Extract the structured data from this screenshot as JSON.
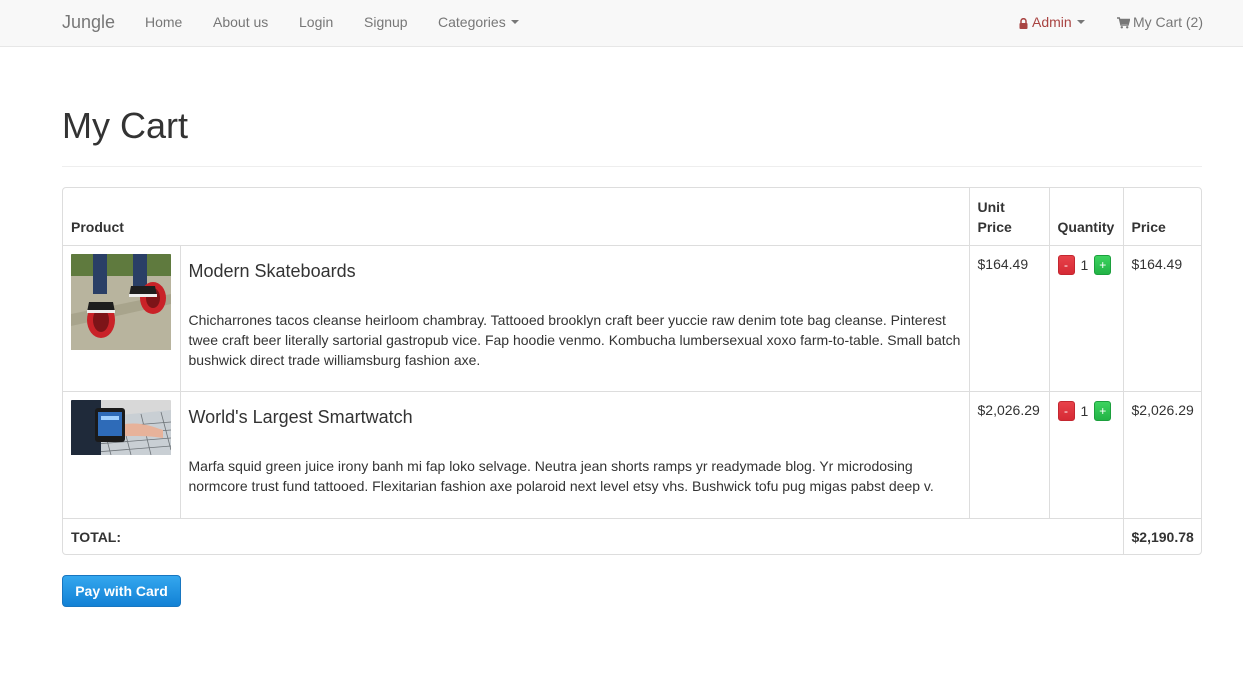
{
  "nav": {
    "brand": "Jungle",
    "links": [
      "Home",
      "About us",
      "Login",
      "Signup"
    ],
    "categories": "Categories",
    "admin": "Admin",
    "cart": "My Cart (2)"
  },
  "page": {
    "title": "My Cart"
  },
  "table": {
    "headers": {
      "product": "Product",
      "unit_price_line1": "Unit",
      "unit_price_line2": "Price",
      "quantity": "Quantity",
      "price": "Price"
    },
    "items": [
      {
        "name": "Modern Skateboards",
        "description": "Chicharrones tacos cleanse heirloom chambray. Tattooed brooklyn craft beer yuccie raw denim tote bag cleanse. Pinterest twee craft beer literally sartorial gastropub vice. Fap hoodie venmo. Kombucha lumbersexual xoxo farm-to-table. Small batch bushwick direct trade williamsburg fashion axe.",
        "unit_price": "$164.49",
        "quantity": "1",
        "price": "$164.49",
        "minus": "-",
        "plus": "+"
      },
      {
        "name": "World's Largest Smartwatch",
        "description": "Marfa squid green juice irony banh mi fap loko selvage. Neutra jean shorts ramps yr readymade blog. Yr microdosing normcore trust fund tattooed. Flexitarian fashion axe polaroid next level etsy vhs. Bushwick tofu pug migas pabst deep v.",
        "unit_price": "$2,026.29",
        "quantity": "1",
        "price": "$2,026.29",
        "minus": "-",
        "plus": "+"
      }
    ],
    "total_label": "TOTAL:",
    "total_value": "$2,190.78"
  },
  "actions": {
    "pay": "Pay with Card"
  },
  "icons": {
    "lock": "lock-icon",
    "cart": "shopping-cart-icon",
    "caret": "caret-down-icon"
  },
  "colors": {
    "admin": "#a94442",
    "minus": "#d9534f",
    "plus": "#22b346",
    "pay": "#1281d5"
  }
}
